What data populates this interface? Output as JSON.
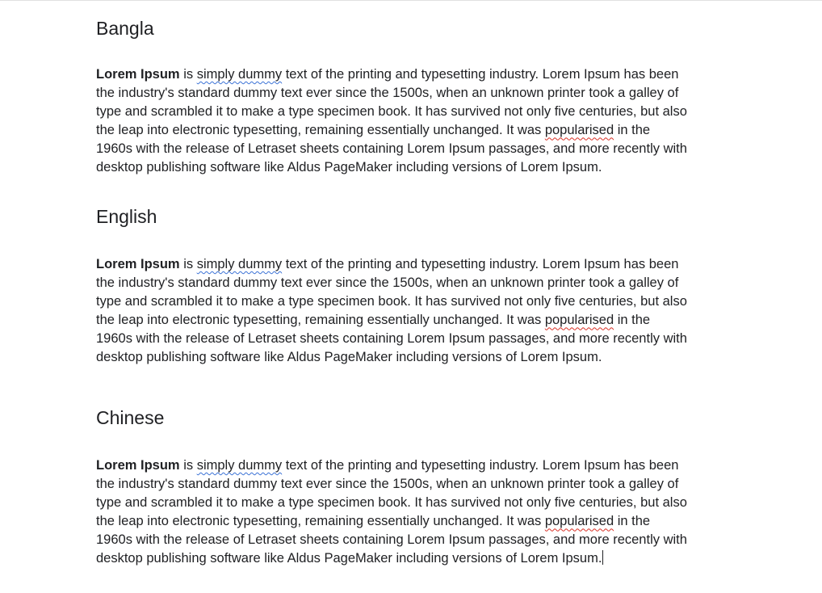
{
  "sections": [
    {
      "heading": "Bangla",
      "lead_bold": "Lorem Ipsum",
      "lead_pre": " is ",
      "lead_spell": "simply dummy",
      "lead_post": " text of the printing and typesetting industry. Lorem Ipsum has been",
      "line2": "the industry's standard dummy text ever since the 1500s, when an unknown printer took a galley of",
      "line3": "type and scrambled it to make a type specimen book. It has survived not only five centuries, but also",
      "line4_pre": "the leap into electronic typesetting, remaining essentially unchanged. It was ",
      "line4_spell": "popularised",
      "line4_post": " in the",
      "line5": "1960s with the release of Letraset sheets containing Lorem Ipsum passages, and more recently with",
      "line6": "desktop publishing software like Aldus PageMaker including versions of Lorem Ipsum."
    },
    {
      "heading": "English",
      "lead_bold": "Lorem Ipsum",
      "lead_pre": " is ",
      "lead_spell": "simply dummy",
      "lead_post": " text of the printing and typesetting industry. Lorem Ipsum has been",
      "line2": "the industry's standard dummy text ever since the 1500s, when an unknown printer took a galley of",
      "line3": "type and scrambled it to make a type specimen book. It has survived not only five centuries, but also",
      "line4_pre": "the leap into electronic typesetting, remaining essentially unchanged. It was ",
      "line4_spell": "popularised",
      "line4_post": " in the",
      "line5": "1960s with the release of Letraset sheets containing Lorem Ipsum passages, and more recently with",
      "line6": "desktop publishing software like Aldus PageMaker including versions of Lorem Ipsum."
    },
    {
      "heading": "Chinese",
      "lead_bold": "Lorem Ipsum",
      "lead_pre": " is ",
      "lead_spell": "simply dummy",
      "lead_post": " text of the printing and typesetting industry. Lorem Ipsum has been",
      "line2": "the industry's standard dummy text ever since the 1500s, when an unknown printer took a galley of",
      "line3": "type and scrambled it to make a type specimen book. It has survived not only five centuries, but also",
      "line4_pre": "the leap into electronic typesetting, remaining essentially unchanged. It was ",
      "line4_spell": "popularised",
      "line4_post": " in the",
      "line5": "1960s with the release of Letraset sheets containing Lorem Ipsum passages, and more recently with",
      "line6": "desktop publishing software like Aldus PageMaker including versions of Lorem Ipsum."
    }
  ],
  "colors": {
    "text": "#202124",
    "spellcheck_blue": "#3b72d6",
    "spellcheck_red": "#d93025",
    "background": "#ffffff"
  }
}
